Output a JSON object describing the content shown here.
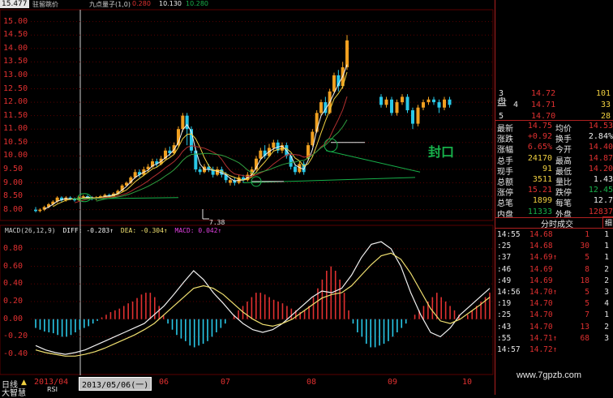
{
  "colors": {
    "up": "#e03030",
    "down": "#29c8e8",
    "up_candle": "#f0a020",
    "ma5": "#f0f0f0",
    "ma10": "#f0d040",
    "ma20": "#b03030",
    "ma_long": "#30a040",
    "label_red": "#e03030",
    "dif": "#f0f0f0",
    "dea": "#f0e070",
    "grid": "#5a0000",
    "green": "#17b04a"
  },
  "header": {
    "price_box": "15.477",
    "indicator": "驻留跳价",
    "items": [
      "九点量子(1,0)",
      "0.280",
      "10.130",
      "10.280"
    ]
  },
  "price_axis": [
    "15.00",
    "14.50",
    "14.00",
    "13.50",
    "13.00",
    "12.50",
    "12.00",
    "11.50",
    "11.00",
    "10.50",
    "10.00",
    "9.50",
    "9.00",
    "8.50",
    "8.00"
  ],
  "price_annot": "7.38",
  "annotation": "封口",
  "macd": {
    "legend_name": "MACD(26,12,9)",
    "diff": "DIFF: -0.283↑",
    "dea": "DEA: -0.304↑",
    "macd": "MACD: 0.042↑",
    "axis": [
      "0.80",
      "0.60",
      "0.40",
      "0.20",
      "0.00",
      "-0.20",
      "-0.40"
    ]
  },
  "bottom": {
    "tab1": "日线",
    "tab2": "大智慧",
    "tab3": "RSI",
    "date_left": "2013/04",
    "date_box": "2013/05/06(一)",
    "months": [
      "06",
      "07",
      "08",
      "09",
      "10"
    ]
  },
  "chart_data": {
    "type": "candlestick",
    "ylim": [
      7.9,
      15.2
    ],
    "macd_ylim": [
      -0.5,
      0.9
    ],
    "candles": [
      [
        8.0,
        7.95,
        8.1,
        7.9
      ],
      [
        7.95,
        8.0,
        8.05,
        7.9
      ],
      [
        8.0,
        8.1,
        8.15,
        7.95
      ],
      [
        8.1,
        8.2,
        8.25,
        8.05
      ],
      [
        8.2,
        8.3,
        8.35,
        8.15
      ],
      [
        8.3,
        8.45,
        8.5,
        8.25
      ],
      [
        8.45,
        8.35,
        8.5,
        8.3
      ],
      [
        8.35,
        8.45,
        8.5,
        8.3
      ],
      [
        8.45,
        8.4,
        8.5,
        8.35
      ],
      [
        8.4,
        8.35,
        8.45,
        8.3
      ],
      [
        8.35,
        8.45,
        8.5,
        8.3
      ],
      [
        8.45,
        8.5,
        8.55,
        8.4
      ],
      [
        8.5,
        8.45,
        8.55,
        8.4
      ],
      [
        8.45,
        8.4,
        8.5,
        8.35
      ],
      [
        8.4,
        8.45,
        8.5,
        8.35
      ],
      [
        8.45,
        8.5,
        8.55,
        8.4
      ],
      [
        8.5,
        8.55,
        8.6,
        8.45
      ],
      [
        8.55,
        8.5,
        8.6,
        8.45
      ],
      [
        8.5,
        8.6,
        8.65,
        8.45
      ],
      [
        8.6,
        8.7,
        8.75,
        8.55
      ],
      [
        8.7,
        8.9,
        8.95,
        8.65
      ],
      [
        8.9,
        9.0,
        9.05,
        8.85
      ],
      [
        9.0,
        9.2,
        9.25,
        8.95
      ],
      [
        9.2,
        9.4,
        9.5,
        9.15
      ],
      [
        9.4,
        9.3,
        9.5,
        9.2
      ],
      [
        9.3,
        9.5,
        9.6,
        9.25
      ],
      [
        9.5,
        9.6,
        9.7,
        9.4
      ],
      [
        9.6,
        9.8,
        9.9,
        9.55
      ],
      [
        9.8,
        9.7,
        9.9,
        9.6
      ],
      [
        9.7,
        9.9,
        10.0,
        9.65
      ],
      [
        9.9,
        10.2,
        10.3,
        9.85
      ],
      [
        10.2,
        10.1,
        10.35,
        10.0
      ],
      [
        10.1,
        10.4,
        10.5,
        10.05
      ],
      [
        10.4,
        11.0,
        11.1,
        10.35
      ],
      [
        11.0,
        11.5,
        11.6,
        10.9
      ],
      [
        11.5,
        11.0,
        11.6,
        10.4
      ],
      [
        11.0,
        10.2,
        11.1,
        10.1
      ],
      [
        10.2,
        9.5,
        10.3,
        9.4
      ],
      [
        9.5,
        9.4,
        9.6,
        9.3
      ],
      [
        9.4,
        9.6,
        9.7,
        9.35
      ],
      [
        9.6,
        9.5,
        9.7,
        9.4
      ],
      [
        9.5,
        9.3,
        9.6,
        9.2
      ],
      [
        9.3,
        9.5,
        9.6,
        9.25
      ],
      [
        9.5,
        9.3,
        9.6,
        9.2
      ],
      [
        9.3,
        9.1,
        9.4,
        9.0
      ],
      [
        9.0,
        9.1,
        9.2,
        8.9
      ],
      [
        9.1,
        9.0,
        9.2,
        8.9
      ],
      [
        9.0,
        9.2,
        9.3,
        8.95
      ],
      [
        9.2,
        9.1,
        9.3,
        9.0
      ],
      [
        9.1,
        9.3,
        9.4,
        9.05
      ],
      [
        9.3,
        9.5,
        9.6,
        9.25
      ],
      [
        9.5,
        9.9,
        10.0,
        9.45
      ],
      [
        9.9,
        10.2,
        10.3,
        9.85
      ],
      [
        10.2,
        10.0,
        10.4,
        9.9
      ],
      [
        10.0,
        10.3,
        10.45,
        9.95
      ],
      [
        10.3,
        10.5,
        10.6,
        10.2
      ],
      [
        10.5,
        10.2,
        10.6,
        10.1
      ],
      [
        10.2,
        10.4,
        10.5,
        10.1
      ],
      [
        10.4,
        10.0,
        10.5,
        9.9
      ],
      [
        10.0,
        9.6,
        10.1,
        9.5
      ],
      [
        9.6,
        9.4,
        9.7,
        9.3
      ],
      [
        9.4,
        9.7,
        9.8,
        9.35
      ],
      [
        9.7,
        9.4,
        9.8,
        9.3
      ],
      [
        9.9,
        10.4,
        10.5,
        9.85
      ],
      [
        10.4,
        10.9,
        11.0,
        10.35
      ],
      [
        10.9,
        11.6,
        11.7,
        10.85
      ],
      [
        11.6,
        12.0,
        12.1,
        11.5
      ],
      [
        12.0,
        11.6,
        12.2,
        11.5
      ],
      [
        11.6,
        12.4,
        12.5,
        11.55
      ],
      [
        12.4,
        13.0,
        13.1,
        12.35
      ],
      [
        13.0,
        12.6,
        13.2,
        12.4
      ],
      [
        12.6,
        13.3,
        13.5,
        12.5
      ],
      [
        13.3,
        14.3,
        14.5,
        13.2
      ]
    ],
    "right_candles": [
      [
        12.2,
        11.9,
        12.3,
        11.8
      ],
      [
        11.9,
        12.1,
        12.2,
        11.8
      ],
      [
        12.1,
        11.6,
        12.2,
        11.5
      ],
      [
        11.6,
        12.0,
        12.1,
        11.5
      ],
      [
        12.0,
        12.2,
        12.3,
        11.9
      ],
      [
        12.2,
        11.7,
        12.3,
        11.6
      ],
      [
        11.7,
        11.2,
        11.8,
        11.0
      ],
      [
        11.2,
        11.8,
        11.9,
        11.1
      ],
      [
        11.8,
        12.0,
        12.1,
        11.7
      ],
      [
        12.0,
        12.1,
        12.2,
        11.9
      ],
      [
        12.1,
        12.0,
        12.2,
        11.9
      ],
      [
        12.0,
        11.8,
        12.1,
        11.6
      ],
      [
        11.8,
        12.1,
        12.2,
        11.7
      ],
      [
        12.1,
        11.9,
        12.2,
        11.8
      ]
    ],
    "macd_hist": [
      -0.1,
      -0.12,
      -0.14,
      -0.15,
      -0.16,
      -0.18,
      -0.2,
      -0.2,
      -0.18,
      -0.15,
      -0.12,
      -0.1,
      -0.08,
      -0.05,
      -0.02,
      0.02,
      0.05,
      0.08,
      0.1,
      0.12,
      0.15,
      0.18,
      0.2,
      0.24,
      0.28,
      0.3,
      0.3,
      0.25,
      0.15,
      0.05,
      -0.05,
      -0.12,
      -0.18,
      -0.22,
      -0.25,
      -0.3,
      -0.32,
      -0.3,
      -0.28,
      -0.25,
      -0.2,
      -0.15,
      -0.1,
      -0.05,
      0.0,
      0.05,
      0.1,
      0.15,
      0.2,
      0.25,
      0.3,
      0.3,
      0.28,
      0.25,
      0.22,
      0.2,
      0.18,
      0.15,
      0.12,
      0.1,
      0.08,
      0.1,
      0.15,
      0.25,
      0.35,
      0.45,
      0.55,
      0.6,
      0.55,
      0.45,
      0.3,
      0.1,
      -0.05,
      -0.15,
      -0.2,
      -0.28,
      -0.32,
      -0.32,
      -0.3,
      -0.28,
      -0.25,
      -0.2,
      -0.15,
      -0.1,
      -0.05,
      0.0,
      0.05,
      0.1,
      0.15,
      0.2,
      0.25,
      0.3,
      0.25,
      0.2,
      0.15,
      0.1,
      0.05,
      0.0,
      0.05,
      0.1,
      0.15,
      0.2,
      0.25,
      0.3
    ],
    "dif": [
      -0.3,
      -0.35,
      -0.38,
      -0.4,
      -0.38,
      -0.35,
      -0.3,
      -0.25,
      -0.2,
      -0.15,
      -0.1,
      -0.05,
      0.05,
      0.15,
      0.28,
      0.42,
      0.55,
      0.45,
      0.3,
      0.18,
      0.05,
      -0.05,
      -0.12,
      -0.15,
      -0.12,
      -0.05,
      0.05,
      0.15,
      0.25,
      0.32,
      0.3,
      0.35,
      0.5,
      0.7,
      0.85,
      0.88,
      0.8,
      0.6,
      0.3,
      0.05,
      -0.15,
      -0.2,
      -0.1,
      0.05,
      0.15,
      0.25,
      0.35
    ],
    "dea": [
      -0.35,
      -0.38,
      -0.4,
      -0.42,
      -0.42,
      -0.4,
      -0.37,
      -0.33,
      -0.28,
      -0.23,
      -0.18,
      -0.12,
      -0.05,
      0.05,
      0.15,
      0.25,
      0.35,
      0.38,
      0.35,
      0.28,
      0.18,
      0.08,
      0.0,
      -0.06,
      -0.08,
      -0.05,
      0.0,
      0.08,
      0.16,
      0.24,
      0.28,
      0.3,
      0.38,
      0.5,
      0.62,
      0.72,
      0.75,
      0.68,
      0.52,
      0.32,
      0.12,
      -0.02,
      -0.05,
      0.0,
      0.08,
      0.16,
      0.25
    ]
  },
  "quote": {
    "book": [
      {
        "label": "3",
        "price": "14.72",
        "vol": "101"
      },
      {
        "label": "盘",
        "sub": "4",
        "price": "14.71",
        "vol": "33"
      },
      {
        "label": "5",
        "price": "14.70",
        "vol": "28"
      }
    ],
    "stats": [
      {
        "k1": "最新",
        "v1": "14.75",
        "k2": "均价",
        "v2": "14.53"
      },
      {
        "k1": "涨跌",
        "v1": "+0.92",
        "k2": "换手",
        "v2": "2.84%"
      },
      {
        "k1": "涨幅",
        "v1": "6.65%",
        "k2": "今开",
        "v2": "14.40"
      },
      {
        "k1": "总手",
        "v1": "24170",
        "k2": "最高",
        "v2": "14.87"
      },
      {
        "k1": "现手",
        "v1": "91",
        "k2": "最低",
        "v2": "14.20"
      },
      {
        "k1": "总额",
        "v1": "3511",
        "k2": "量比",
        "v2": "1.43"
      },
      {
        "k1": "涨停",
        "v1": "15.21",
        "k2": "跌停",
        "v2": "12.45"
      },
      {
        "k1": "总笔",
        "v1": "1899",
        "k2": "每笔",
        "v2": "12.7"
      },
      {
        "k1": "内盘",
        "v1": "11333",
        "k2": "外盘",
        "v2": "12837"
      }
    ],
    "ticks_header": "分时成交",
    "ticks_tab": "细",
    "ticks": [
      {
        "t": "14:55",
        "p": "14.68",
        "v": "1",
        "n": "1"
      },
      {
        "t": ":25",
        "p": "14.68",
        "v": "30",
        "n": "1"
      },
      {
        "t": ":37",
        "p": "14.69↑",
        "v": "5",
        "n": "1"
      },
      {
        "t": ":46",
        "p": "14.69",
        "v": "8",
        "n": "2"
      },
      {
        "t": ":49",
        "p": "14.69",
        "v": "18",
        "n": "2"
      },
      {
        "t": "14:56",
        "p": "14.70↑",
        "v": "5",
        "n": "3"
      },
      {
        "t": ":19",
        "p": "14.70",
        "v": "5",
        "n": "4"
      },
      {
        "t": ":25",
        "p": "14.70",
        "v": "7",
        "n": "1"
      },
      {
        "t": ":43",
        "p": "14.70",
        "v": "13",
        "n": "2"
      },
      {
        "t": ":55",
        "p": "14.71↑",
        "v": "68",
        "n": "3"
      },
      {
        "t": "14:57",
        "p": "14.72↑",
        "v": "",
        "n": ""
      }
    ],
    "watermark": "www.7gpzb.com"
  }
}
